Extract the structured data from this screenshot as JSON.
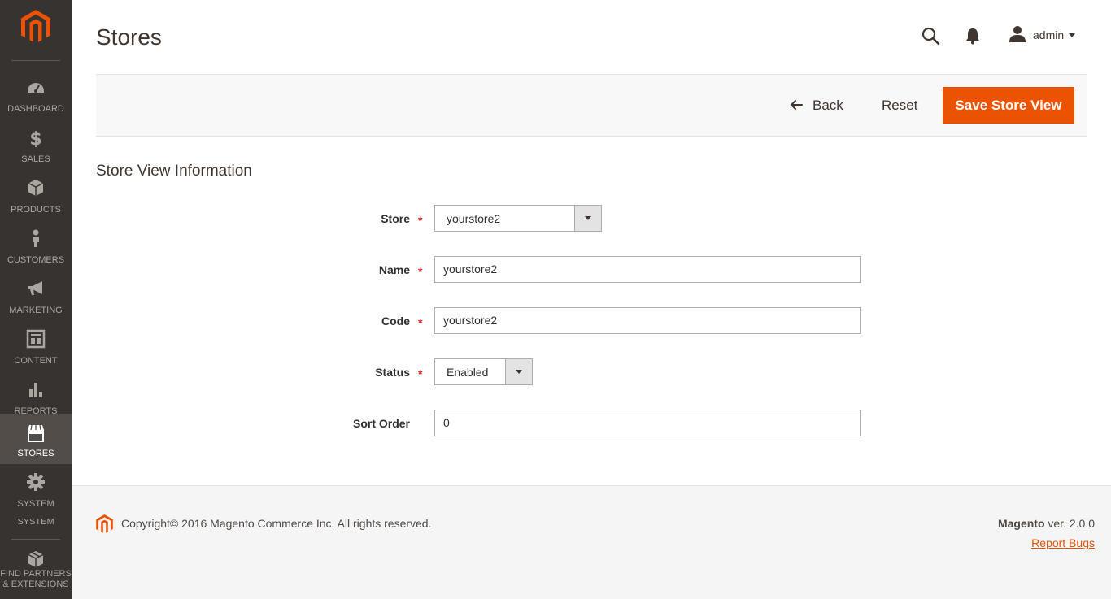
{
  "sidebar": {
    "logo_icon": "magento-logo-icon",
    "items": [
      {
        "label": "DASHBOARD",
        "icon": "dashboard-icon"
      },
      {
        "label": "SALES",
        "icon": "dollar-icon"
      },
      {
        "label": "PRODUCTS",
        "icon": "box-icon"
      },
      {
        "label": "CUSTOMERS",
        "icon": "person-icon"
      },
      {
        "label": "MARKETING",
        "icon": "megaphone-icon"
      },
      {
        "label": "CONTENT",
        "icon": "layout-icon"
      },
      {
        "label": "REPORTS",
        "icon": "bar-chart-icon"
      },
      {
        "label": "STORES",
        "icon": "storefront-icon",
        "active": true
      },
      {
        "label": "SYSTEM",
        "icon": "gear-icon"
      }
    ],
    "cut_label": "SYSTEM",
    "partners_label_line1": "FIND PARTNERS",
    "partners_label_line2": "& EXTENSIONS"
  },
  "header": {
    "title": "Stores",
    "user_name": "admin"
  },
  "actions": {
    "back_label": "Back",
    "reset_label": "Reset",
    "save_label": "Save Store View"
  },
  "section": {
    "title": "Store View Information"
  },
  "form": {
    "store": {
      "label": "Store",
      "value": "yourstore2",
      "required": true
    },
    "name": {
      "label": "Name",
      "value": "yourstore2",
      "required": true
    },
    "code": {
      "label": "Code",
      "value": "yourstore2",
      "required": true
    },
    "status": {
      "label": "Status",
      "value": "Enabled",
      "required": true
    },
    "sort_order": {
      "label": "Sort Order",
      "value": "0",
      "required": false
    },
    "required_marker": "*"
  },
  "footer": {
    "copyright": "Copyright© 2016 Magento Commerce Inc. All rights reserved.",
    "brand": "Magento",
    "version": " ver. 2.0.0",
    "report_bugs": "Report Bugs"
  },
  "colors": {
    "accent": "#eb5202",
    "sidebar_bg": "#373330",
    "required": "#e22626"
  }
}
